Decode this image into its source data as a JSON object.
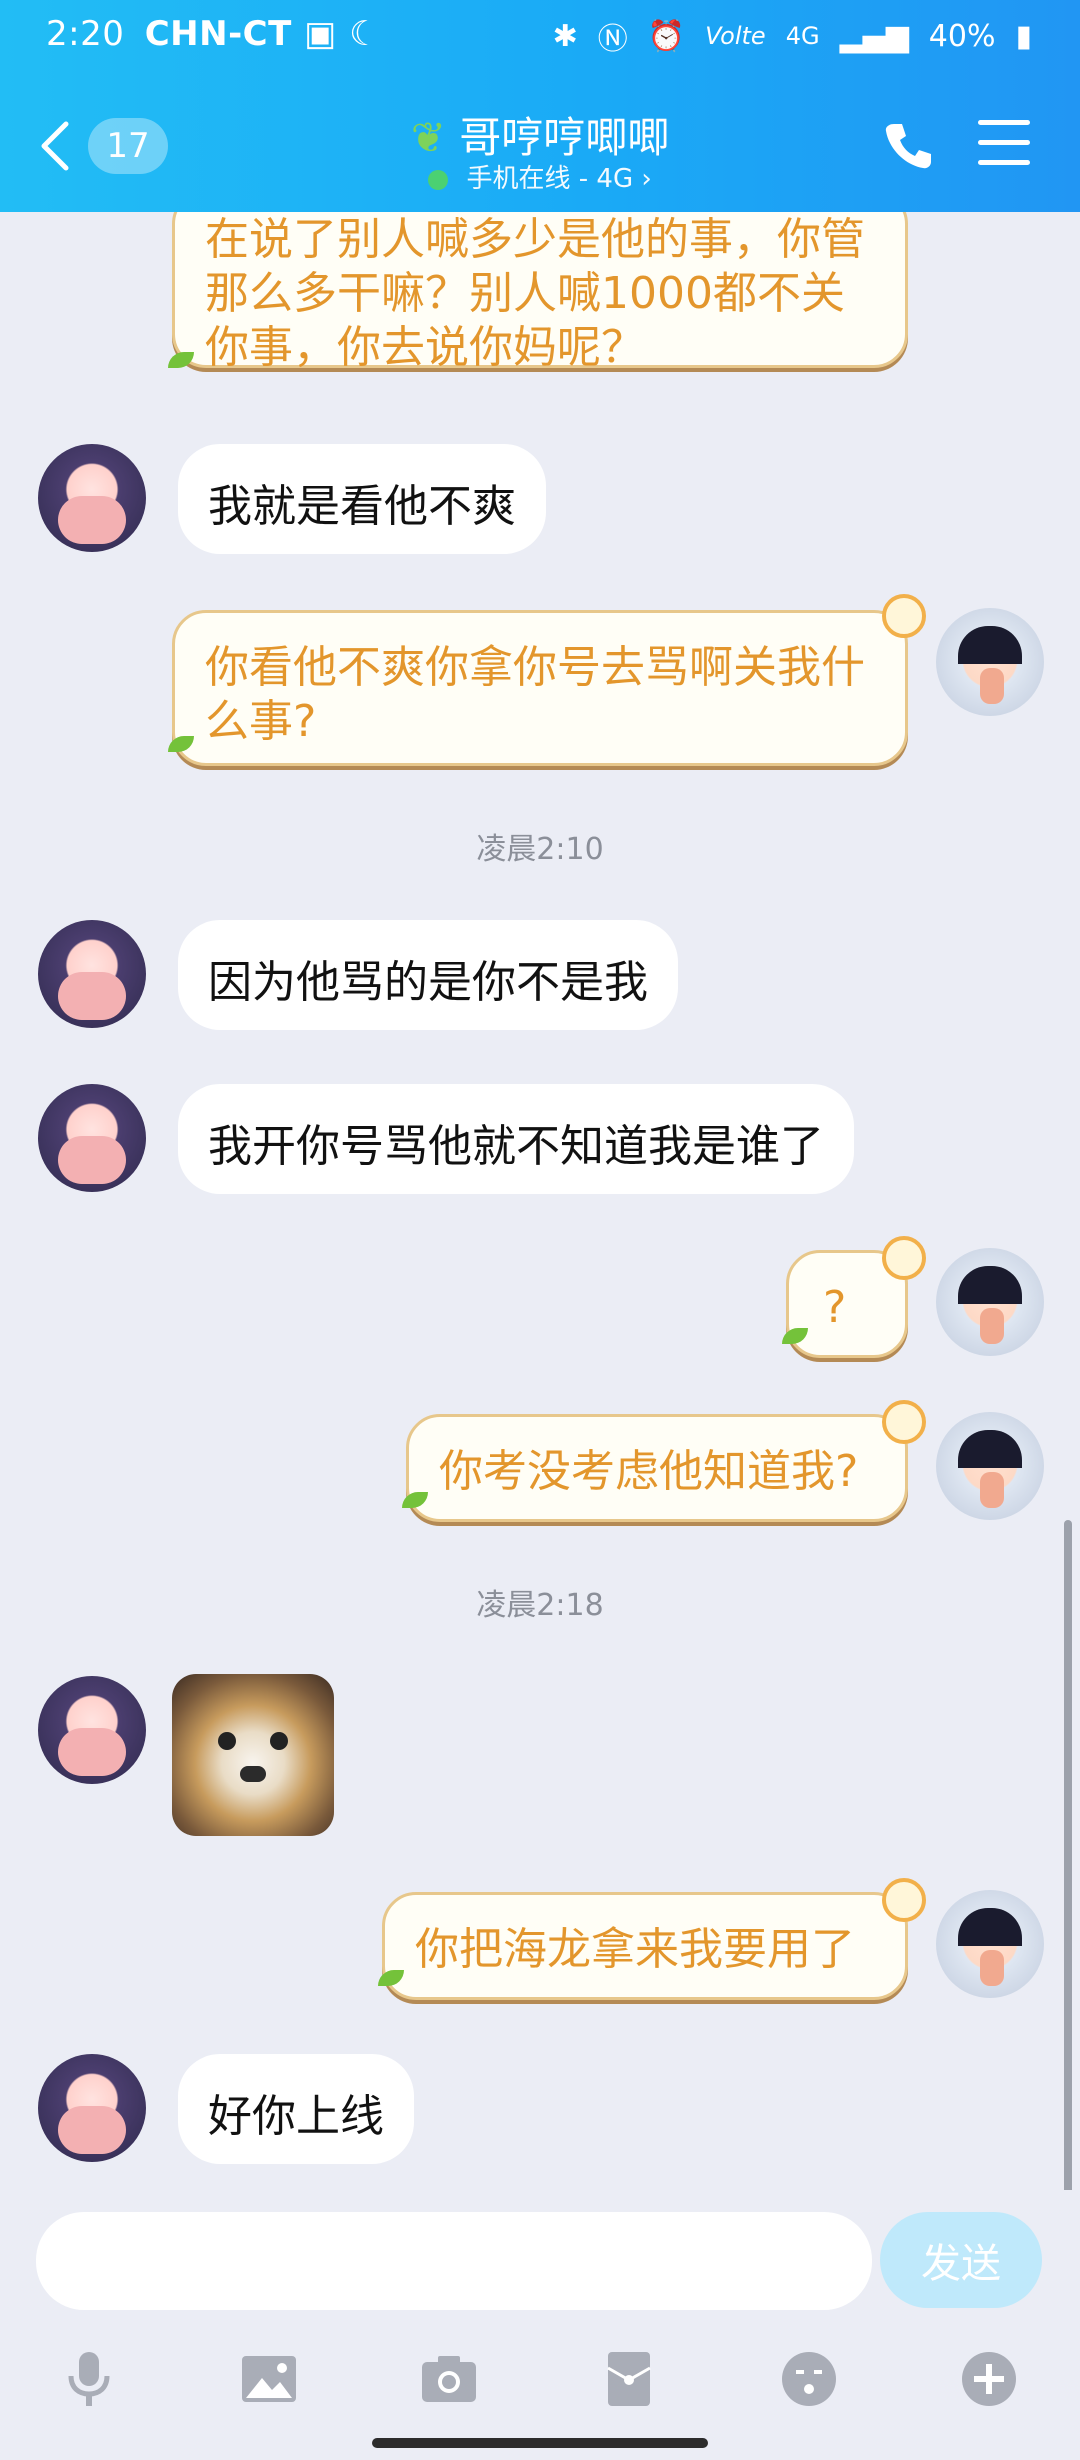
{
  "status_bar": {
    "time": "2:20",
    "carrier": "CHN-CT",
    "battery": "40%"
  },
  "header": {
    "back_badge": "17",
    "title": "哥哼哼唧唧",
    "subtitle": "手机在线 - 4G"
  },
  "messages": [
    {
      "side": "right",
      "text": "在说了别人喊多少是他的事，你管那么多干嘛？别人喊1000都不关你事，你去说你妈呢？"
    },
    {
      "side": "left",
      "text": "我就是看他不爽"
    },
    {
      "side": "right",
      "text": "你看他不爽你拿你号去骂啊关我什么事?"
    },
    {
      "side": "time",
      "text": "凌晨2:10"
    },
    {
      "side": "left",
      "text": "因为他骂的是你不是我"
    },
    {
      "side": "left",
      "text": "我开你号骂他就不知道我是谁了"
    },
    {
      "side": "right",
      "text": "?"
    },
    {
      "side": "right",
      "text": "你考没考虑他知道我?"
    },
    {
      "side": "time",
      "text": "凌晨2:18"
    },
    {
      "side": "left",
      "text": "",
      "image": "doge-sticker"
    },
    {
      "side": "right",
      "text": "你把海龙拿来我要用了"
    },
    {
      "side": "left",
      "text": "好你上线"
    }
  ],
  "composer": {
    "placeholder": "",
    "send_label": "发送"
  },
  "toolbar_icons": [
    "microphone-icon",
    "image-icon",
    "camera-icon",
    "red-packet-icon",
    "emoji-icon",
    "plus-icon"
  ],
  "colors": {
    "header_start": "#22bdf5",
    "header_end": "#2196f3",
    "bubble_right_text": "#e3962c",
    "background": "#ebedf5"
  }
}
